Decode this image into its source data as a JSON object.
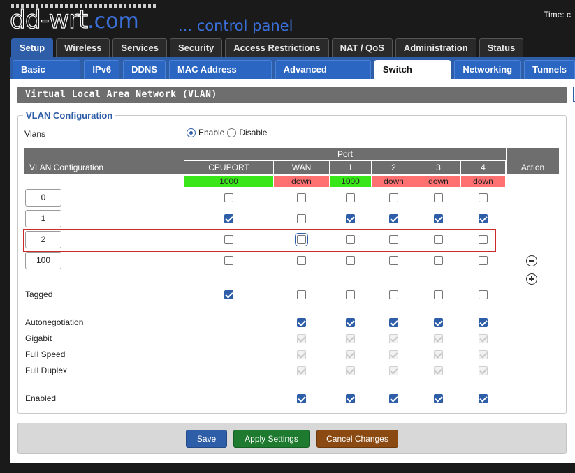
{
  "header": {
    "logo": "dd-wrt",
    "logo_com": ".com",
    "subtitle": "... control panel",
    "time_label": "Time: c"
  },
  "main_tabs": [
    {
      "label": "Setup",
      "active": true
    },
    {
      "label": "Wireless",
      "active": false
    },
    {
      "label": "Services",
      "active": false
    },
    {
      "label": "Security",
      "active": false
    },
    {
      "label": "Access Restrictions",
      "active": false
    },
    {
      "label": "NAT / QoS",
      "active": false
    },
    {
      "label": "Administration",
      "active": false
    },
    {
      "label": "Status",
      "active": false
    }
  ],
  "sub_tabs": [
    {
      "label": "Basic Setup",
      "active": false
    },
    {
      "label": "IPv6",
      "active": false
    },
    {
      "label": "DDNS",
      "active": false
    },
    {
      "label": "MAC Address Clone",
      "active": false
    },
    {
      "label": "Advanced Routing",
      "active": false
    },
    {
      "label": "Switch Config",
      "active": true
    },
    {
      "label": "Networking",
      "active": false
    },
    {
      "label": "Tunnels",
      "active": false
    }
  ],
  "section": {
    "title": "Virtual Local Area Network (VLAN)",
    "legend": "VLAN Configuration",
    "vlans_label": "Vlans",
    "enable_label": "Enable",
    "disable_label": "Disable",
    "vlans_enabled": true
  },
  "table": {
    "vlan_col_header": "VLAN Configuration",
    "port_header": "Port",
    "action_header": "Action",
    "ports": [
      {
        "name": "CPUPORT",
        "speed": "1000",
        "status": "up"
      },
      {
        "name": "WAN",
        "speed": "down",
        "status": "down"
      },
      {
        "name": "1",
        "speed": "1000",
        "status": "up"
      },
      {
        "name": "2",
        "speed": "down",
        "status": "down"
      },
      {
        "name": "3",
        "speed": "down",
        "status": "down"
      },
      {
        "name": "4",
        "speed": "down",
        "status": "down"
      }
    ],
    "vlans": [
      {
        "id": "0",
        "checks": [
          false,
          false,
          false,
          false,
          false,
          false
        ]
      },
      {
        "id": "1",
        "checks": [
          true,
          false,
          true,
          true,
          true,
          true
        ]
      },
      {
        "id": "2",
        "checks": [
          false,
          false,
          false,
          false,
          false,
          false
        ],
        "highlighted": true
      },
      {
        "id": "100",
        "checks": [
          false,
          false,
          false,
          false,
          false,
          false
        ]
      }
    ],
    "option_rows": [
      {
        "label": "Tagged",
        "checks": [
          true,
          false,
          false,
          false,
          false,
          false
        ],
        "disabled": false,
        "has_cpu": true
      },
      {
        "label": "Autonegotiation",
        "checks": [
          null,
          true,
          true,
          true,
          true,
          true
        ],
        "disabled": false,
        "has_cpu": false
      },
      {
        "label": "Gigabit",
        "checks": [
          null,
          true,
          true,
          true,
          true,
          true
        ],
        "disabled": true,
        "has_cpu": false
      },
      {
        "label": "Full Speed",
        "checks": [
          null,
          true,
          true,
          true,
          true,
          true
        ],
        "disabled": true,
        "has_cpu": false
      },
      {
        "label": "Full Duplex",
        "checks": [
          null,
          true,
          true,
          true,
          true,
          true
        ],
        "disabled": true,
        "has_cpu": false
      },
      {
        "label": "Enabled",
        "checks": [
          null,
          true,
          true,
          true,
          true,
          true
        ],
        "disabled": false,
        "has_cpu": false
      }
    ]
  },
  "buttons": {
    "save": "Save",
    "apply": "Apply Settings",
    "cancel": "Cancel Changes"
  },
  "colors": {
    "accent": "#2f5ea8",
    "port_up": "#39e61a",
    "port_down": "#ff7070",
    "highlight_border": "#cc2b2b"
  }
}
